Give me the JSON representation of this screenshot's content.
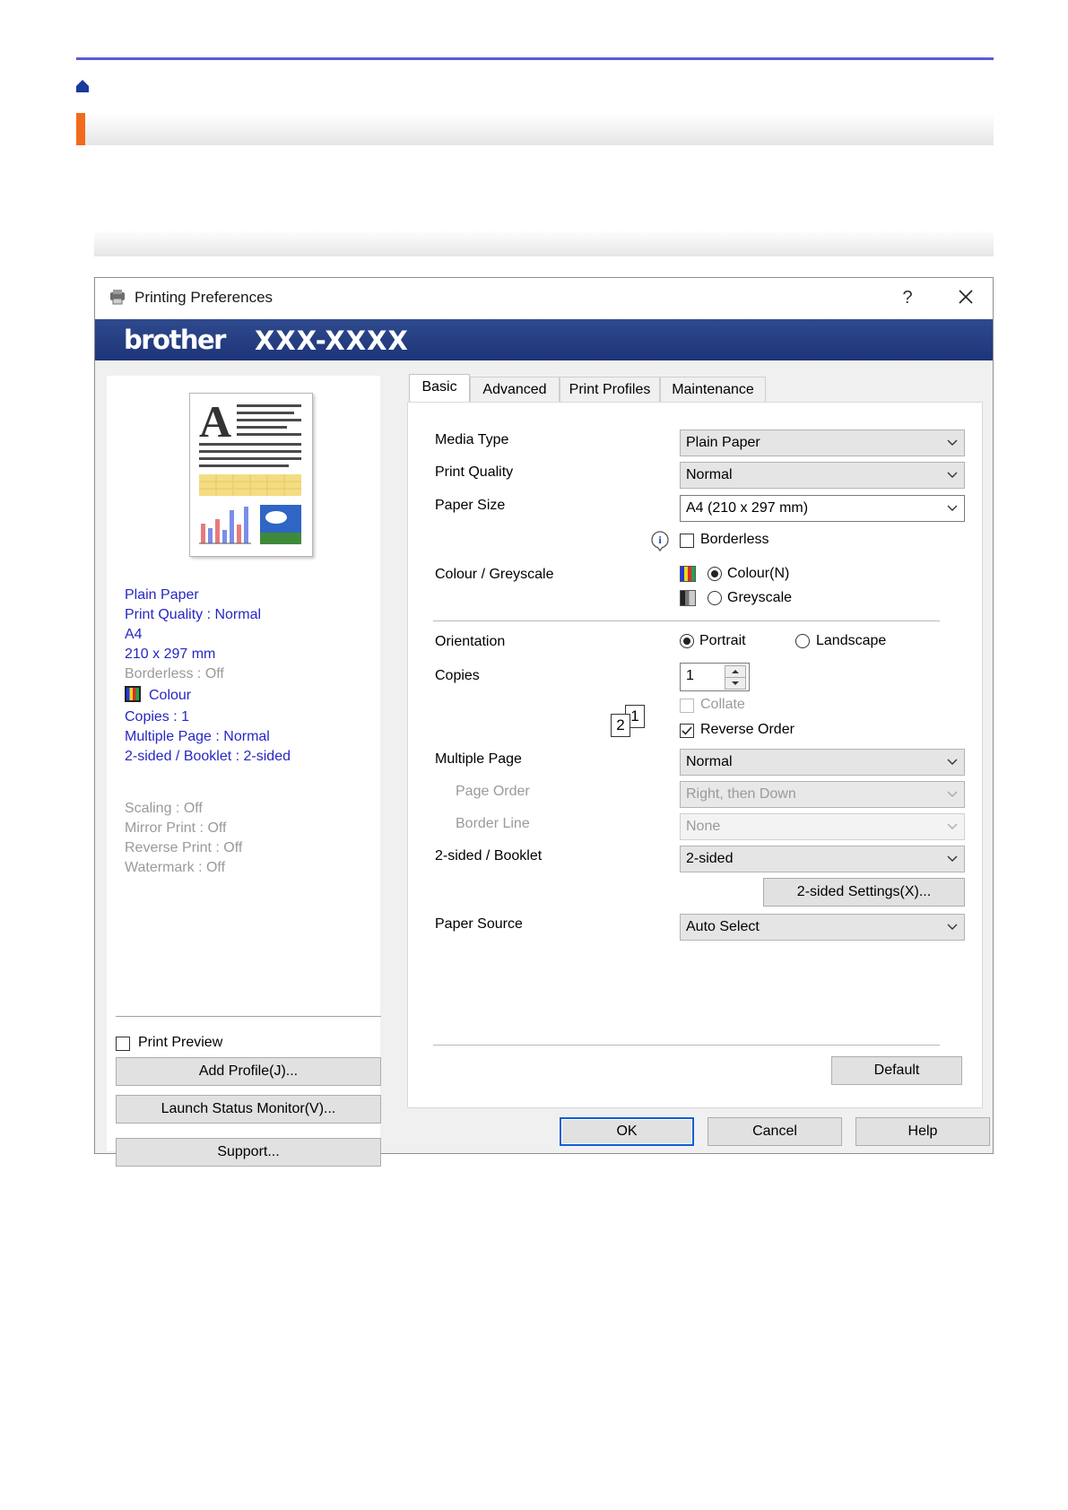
{
  "dialog": {
    "title": "Printing Preferences",
    "help_glyph": "?",
    "brand": "brother",
    "model": "XXX-XXXX"
  },
  "summary": {
    "media": "Plain Paper",
    "quality": "Print Quality : Normal",
    "size": "A4",
    "dimensions": "210 x 297 mm",
    "borderless": "Borderless : Off",
    "colour": "Colour",
    "copies": "Copies : 1",
    "multiple_page": "Multiple Page : Normal",
    "two_sided": "2-sided / Booklet : 2-sided",
    "scaling": "Scaling : Off",
    "mirror": "Mirror Print : Off",
    "reverse": "Reverse Print : Off",
    "watermark": "Watermark : Off"
  },
  "left_actions": {
    "print_preview": "Print Preview",
    "add_profile": "Add Profile(J)...",
    "launch_status": "Launch Status Monitor(V)...",
    "support": "Support..."
  },
  "tabs": [
    "Basic",
    "Advanced",
    "Print Profiles",
    "Maintenance"
  ],
  "basic": {
    "media_type_label": "Media Type",
    "media_type_value": "Plain Paper",
    "print_quality_label": "Print Quality",
    "print_quality_value": "Normal",
    "paper_size_label": "Paper Size",
    "paper_size_value": "A4 (210 x 297 mm)",
    "borderless_label": "Borderless",
    "colour_label": "Colour / Greyscale",
    "colour_option": "Colour(N)",
    "greyscale_option": "Greyscale",
    "orientation_label": "Orientation",
    "portrait": "Portrait",
    "landscape": "Landscape",
    "copies_label": "Copies",
    "copies_value": "1",
    "collate": "Collate",
    "reverse_order": "Reverse Order",
    "multiple_page_label": "Multiple Page",
    "multiple_page_value": "Normal",
    "page_order_label": "Page Order",
    "page_order_value": "Right, then Down",
    "border_line_label": "Border Line",
    "border_line_value": "None",
    "two_sided_label": "2-sided / Booklet",
    "two_sided_value": "2-sided",
    "two_sided_settings": "2-sided Settings(X)...",
    "paper_source_label": "Paper Source",
    "paper_source_value": "Auto Select",
    "default_button": "Default",
    "collate_icon_front": "1",
    "collate_icon_back": "2"
  },
  "footer": {
    "ok": "OK",
    "cancel": "Cancel",
    "help": "Help"
  },
  "state": {
    "borderless_checked": false,
    "colour_selected": "Colour",
    "orientation": "Portrait",
    "collate_checked": false,
    "collate_enabled": false,
    "reverse_order_checked": true,
    "print_preview_checked": false
  },
  "colors": {
    "header_rule": "#5b5bd6",
    "heading_accent": "#f26a1b",
    "banner": "#1d3478",
    "summary_text": "#2727c4"
  }
}
